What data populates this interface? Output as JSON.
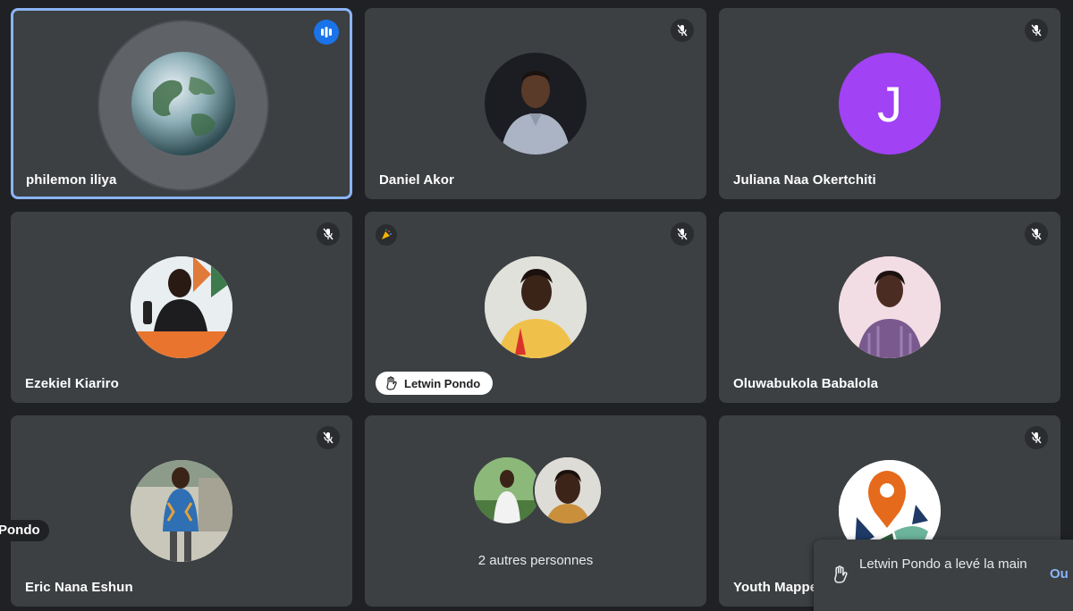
{
  "participants": [
    {
      "name": "philemon iliya",
      "state": "speaking"
    },
    {
      "name": "Daniel Akor",
      "state": "muted"
    },
    {
      "name": "Juliana Naa Okertchiti",
      "state": "muted",
      "initial": "J",
      "avatar_color": "#a142f4"
    },
    {
      "name": "Ezekiel Kiariro",
      "state": "muted"
    },
    {
      "name": "Letwin Pondo",
      "state": "muted",
      "hand_raised": true,
      "reaction_icon": "party-popper-icon"
    },
    {
      "name": "Oluwabukola Babalola",
      "state": "muted"
    },
    {
      "name": "Eric Nana Eshun",
      "state": "muted"
    },
    {
      "name": "",
      "others_label": "2 autres personnes"
    },
    {
      "name": "Youth Mappe",
      "state": "muted"
    }
  ],
  "edge_label": "Pondo",
  "toast": {
    "message": "Letwin Pondo a levé la main",
    "action": "Ou"
  },
  "colors": {
    "background": "#202124",
    "tile": "#3c4043",
    "speaking_border": "#8ab4f8",
    "accent": "#1a73e8"
  }
}
